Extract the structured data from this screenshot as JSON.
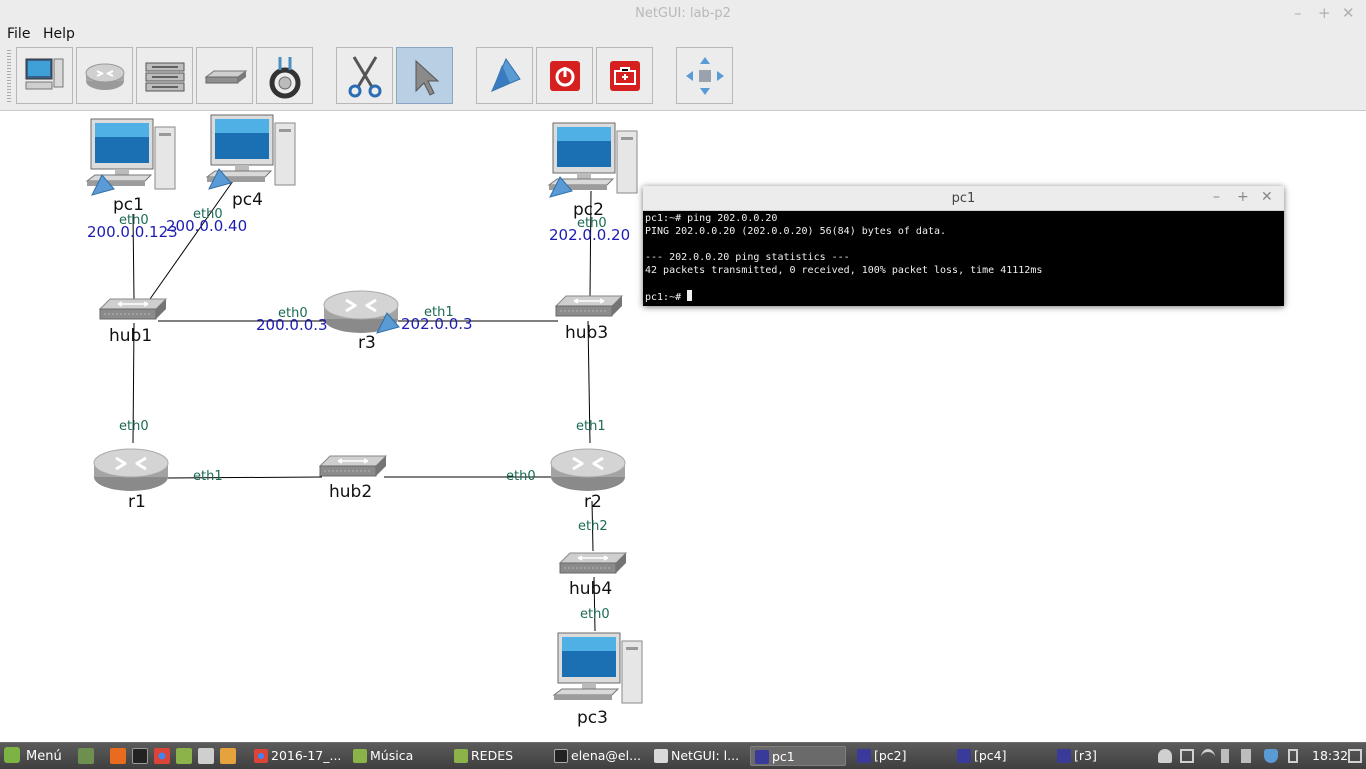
{
  "window": {
    "title": "NetGUI: lab-p2"
  },
  "menu": [
    "File",
    "Help"
  ],
  "toolbar": [
    {
      "icon": "terminal-pc-icon",
      "active": false
    },
    {
      "icon": "router-icon",
      "active": false
    },
    {
      "icon": "switch-icon",
      "active": false
    },
    {
      "icon": "hub-icon",
      "active": false
    },
    {
      "icon": "cable-icon",
      "active": false
    },
    {
      "icon": "scissors-icon",
      "active": false
    },
    {
      "icon": "pointer-icon",
      "active": true
    },
    {
      "icon": "start-arrow-icon",
      "active": false
    },
    {
      "icon": "power-icon",
      "active": false
    },
    {
      "icon": "toolbox-icon",
      "active": false
    },
    {
      "icon": "move-arrows-icon",
      "active": false
    }
  ],
  "devices": {
    "pc1": "pc1",
    "pc4": "pc4",
    "pc2": "pc2",
    "pc3": "pc3",
    "r1": "r1",
    "r2": "r2",
    "r3": "r3",
    "hub1": "hub1",
    "hub2": "hub2",
    "hub3": "hub3",
    "hub4": "hub4"
  },
  "interfaces": {
    "pc1_eth0": "eth0",
    "pc4_eth0": "eth0",
    "pc2_eth0": "eth0",
    "r3_eth0": "eth0",
    "r3_eth1": "eth1",
    "r1_eth0": "eth0",
    "r1_eth1": "eth1",
    "r2_eth0": "eth0",
    "r2_eth1": "eth1",
    "r2_eth2": "eth2",
    "pc3_eth0": "eth0"
  },
  "ips": {
    "pc1": "200.0.0.123",
    "pc4": "200.0.0.40",
    "pc2": "202.0.0.20",
    "r3_eth0": "200.0.0.3",
    "r3_eth1": "202.0.0.3"
  },
  "terminal": {
    "title": "pc1",
    "lines": [
      "pc1:~# ping 202.0.0.20",
      "PING 202.0.0.20 (202.0.0.20) 56(84) bytes of data.",
      "",
      "--- 202.0.0.20 ping statistics ---",
      "42 packets transmitted, 0 received, 100% packet loss, time 41112ms",
      ""
    ],
    "prompt": "pc1:~# "
  },
  "taskbar": {
    "menu": "Menú",
    "tasks": [
      {
        "label": "2016-17_...",
        "icon": "chrome-icon"
      },
      {
        "label": "Música",
        "icon": "folder-icon"
      },
      {
        "label": "REDES",
        "icon": "folder-icon"
      },
      {
        "label": "elena@el...",
        "icon": "terminal-icon"
      },
      {
        "label": "NetGUI: l...",
        "icon": "netgui-icon"
      },
      {
        "label": "pc1",
        "icon": "xterm-icon"
      },
      {
        "label": "[pc2]",
        "icon": "xterm-icon"
      },
      {
        "label": "[pc4]",
        "icon": "xterm-icon"
      },
      {
        "label": "[r3]",
        "icon": "xterm-icon"
      }
    ],
    "clock": "18:32"
  }
}
